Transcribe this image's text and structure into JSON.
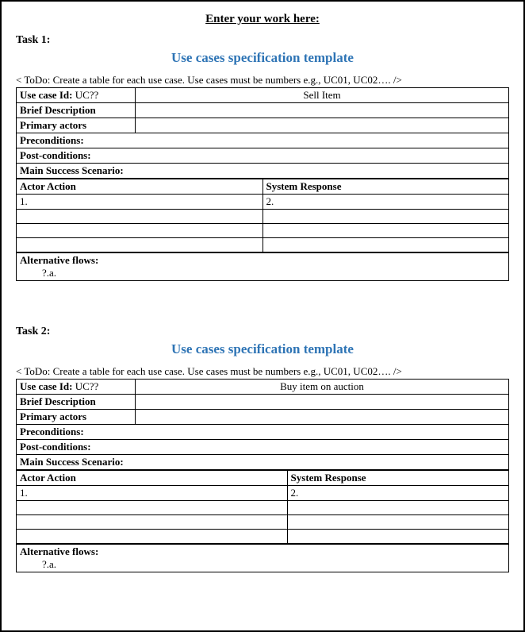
{
  "pageTitle": "Enter your work here:",
  "todoText": "< ToDo: Create a table for each use case. Use cases must be numbers e.g., UC01, UC02…. />",
  "task1": {
    "label": "Task 1:",
    "sectionTitle": "Use cases specification template",
    "useCaseIdLabel": "Use case Id:",
    "useCaseIdValue": "UC??",
    "useCaseName": "Sell Item",
    "briefDescLabel": "Brief Description",
    "primaryActorsLabel": "Primary actors",
    "preconditionsLabel": "Preconditions:",
    "postConditionsLabel": "Post-conditions:",
    "mainScenarioLabel": "Main Success Scenario:",
    "actorActionLabel": "Actor Action",
    "systemResponseLabel": "System Response",
    "row1Left": "1.",
    "row1Right": "2.",
    "altFlowsLabel": "Alternative flows:",
    "altFlowsItem": "?.a."
  },
  "task2": {
    "label": "Task 2:",
    "sectionTitle": "Use cases specification template",
    "useCaseIdLabel": "Use case Id:",
    "useCaseIdValue": "UC??",
    "useCaseName": "Buy item on auction",
    "briefDescLabel": "Brief Description",
    "primaryActorsLabel": "Primary actors",
    "preconditionsLabel": "Preconditions:",
    "postConditionsLabel": "Post-conditions:",
    "mainScenarioLabel": "Main Success Scenario:",
    "actorActionLabel": "Actor Action",
    "systemResponseLabel": "System Response",
    "row1Left": "1.",
    "row1Right": "2.",
    "altFlowsLabel": "Alternative flows:",
    "altFlowsItem": "?.a."
  }
}
